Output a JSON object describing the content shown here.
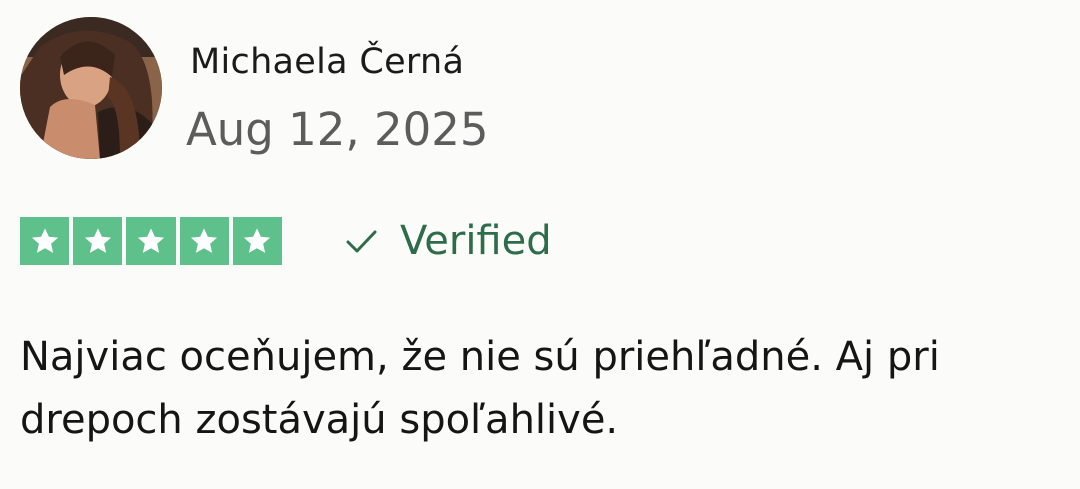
{
  "review": {
    "author": "Michaela Černá",
    "date": "Aug 12, 2025",
    "rating": 5,
    "rating_max": 5,
    "verified_label": "Verified",
    "text_line1": "Najviac oceňujem, že nie sú priehľadné. Aj pri",
    "text_line2": "drepoch zostávajú spoľahlivé."
  },
  "colors": {
    "star_green": "#5ec08a",
    "verified_green": "#2e6d4a"
  },
  "icons": {
    "avatar": "avatar-photo",
    "star": "star-icon",
    "check": "check-icon"
  }
}
